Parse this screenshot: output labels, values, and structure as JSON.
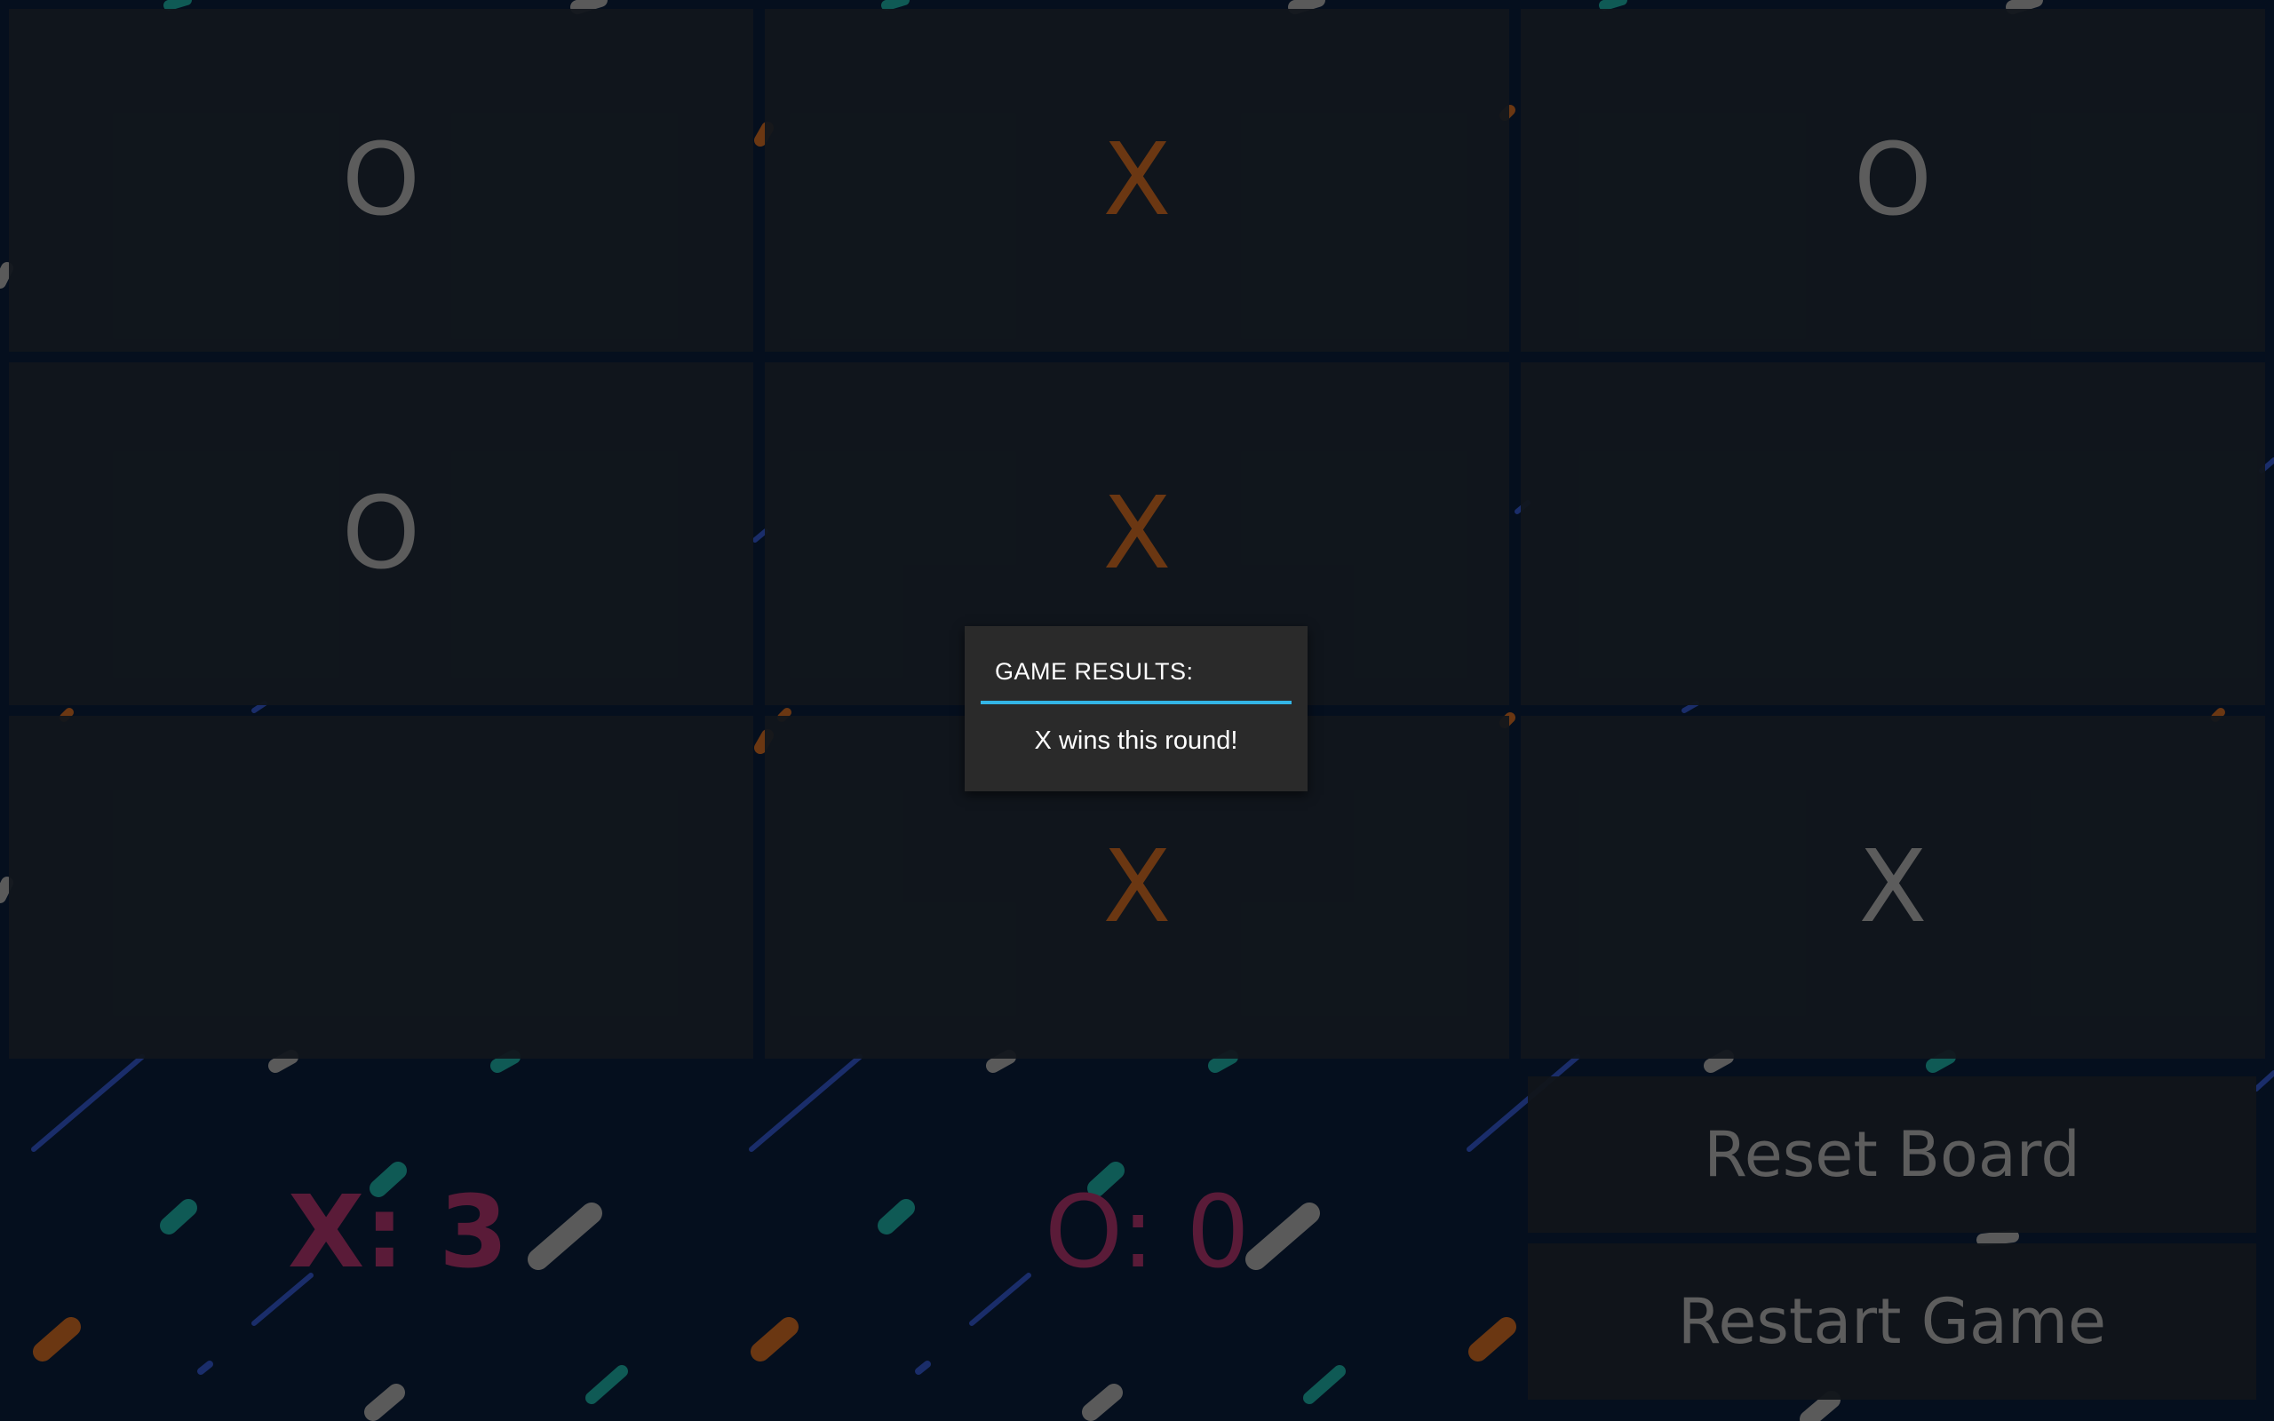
{
  "colors": {
    "background": "#050f1e",
    "cell": "#11161c",
    "x_mark": "#6b3712",
    "o_mark": "#5c5c5c",
    "score": "#5a1b38",
    "button_text": "#5d5d5d",
    "dialog_bg": "#2a2a2a",
    "dialog_accent": "#33b5e5"
  },
  "board": {
    "cells": [
      {
        "mark": "O",
        "style": "o"
      },
      {
        "mark": "X",
        "style": "x"
      },
      {
        "mark": "O",
        "style": "o"
      },
      {
        "mark": "O",
        "style": "o"
      },
      {
        "mark": "X",
        "style": "x"
      },
      {
        "mark": "",
        "style": "o"
      },
      {
        "mark": "",
        "style": "o"
      },
      {
        "mark": "X",
        "style": "x"
      },
      {
        "mark": "X",
        "style": "x-alt"
      }
    ]
  },
  "scores": {
    "x_label": "X: 3",
    "o_label": "O: 0"
  },
  "buttons": {
    "reset_label": "Reset Board",
    "restart_label": "Restart Game"
  },
  "dialog": {
    "title": "GAME RESULTS:",
    "message": "X wins this round!"
  }
}
